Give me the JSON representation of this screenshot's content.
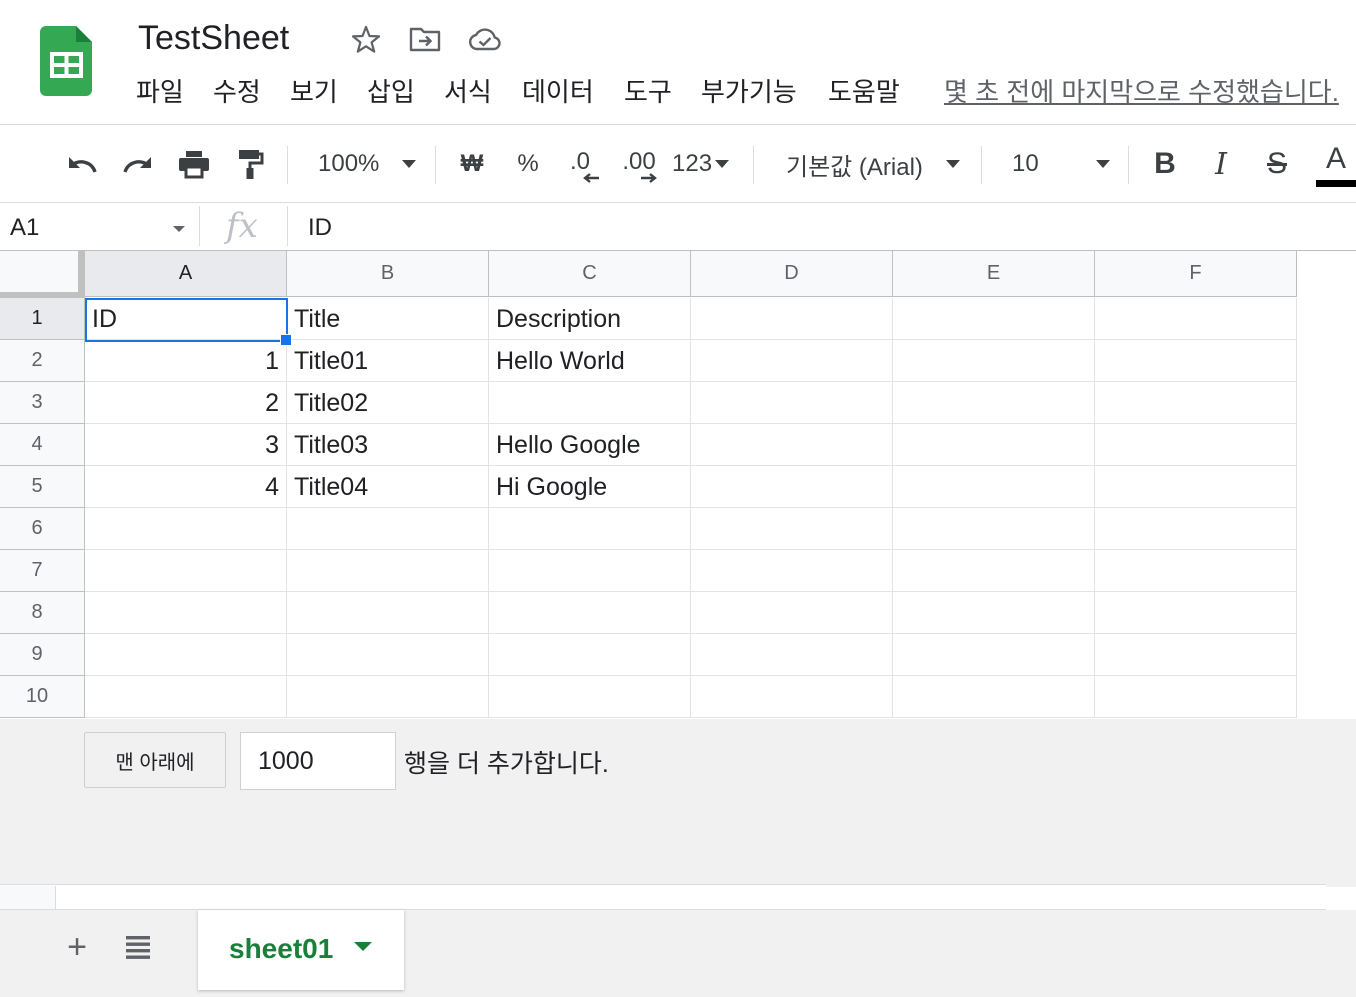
{
  "app": {
    "title": "TestSheet",
    "last_edit": "몇 초 전에 마지막으로 수정했습니다.",
    "accent_color": "#188038",
    "selection_color": "#1a73e8"
  },
  "menu": [
    "파일",
    "수정",
    "보기",
    "삽입",
    "서식",
    "데이터",
    "도구",
    "부가기능",
    "도움말"
  ],
  "toolbar": {
    "zoom": "100%",
    "currency": "₩",
    "percent": "%",
    "decrease_decimal": ".0",
    "increase_decimal": ".00",
    "more_formats": "123",
    "font": "기본값 (Arial)",
    "font_size": "10",
    "bold": "B",
    "italic": "I",
    "strike": "S",
    "text_color": "A"
  },
  "formula_bar": {
    "cell_ref": "A1",
    "fx": "fx",
    "value": "ID"
  },
  "grid": {
    "columns": [
      "A",
      "B",
      "C",
      "D",
      "E",
      "F"
    ],
    "row_numbers": [
      "1",
      "2",
      "3",
      "4",
      "5",
      "6",
      "7",
      "8",
      "9",
      "10"
    ],
    "rows": [
      [
        "ID",
        "Title",
        "Description",
        "",
        "",
        ""
      ],
      [
        "1",
        "Title01",
        "Hello World",
        "",
        "",
        ""
      ],
      [
        "2",
        "Title02",
        "",
        "",
        "",
        ""
      ],
      [
        "3",
        "Title03",
        "Hello Google",
        "",
        "",
        ""
      ],
      [
        "4",
        "Title04",
        "Hi Google",
        "",
        "",
        ""
      ],
      [
        "",
        "",
        "",
        "",
        "",
        ""
      ],
      [
        "",
        "",
        "",
        "",
        "",
        ""
      ],
      [
        "",
        "",
        "",
        "",
        "",
        ""
      ],
      [
        "",
        "",
        "",
        "",
        "",
        ""
      ],
      [
        "",
        "",
        "",
        "",
        "",
        ""
      ]
    ]
  },
  "add_rows": {
    "button": "맨 아래에",
    "count": "1000",
    "suffix": "행을 더 추가합니다."
  },
  "sheets": {
    "add": "+",
    "active": "sheet01"
  }
}
